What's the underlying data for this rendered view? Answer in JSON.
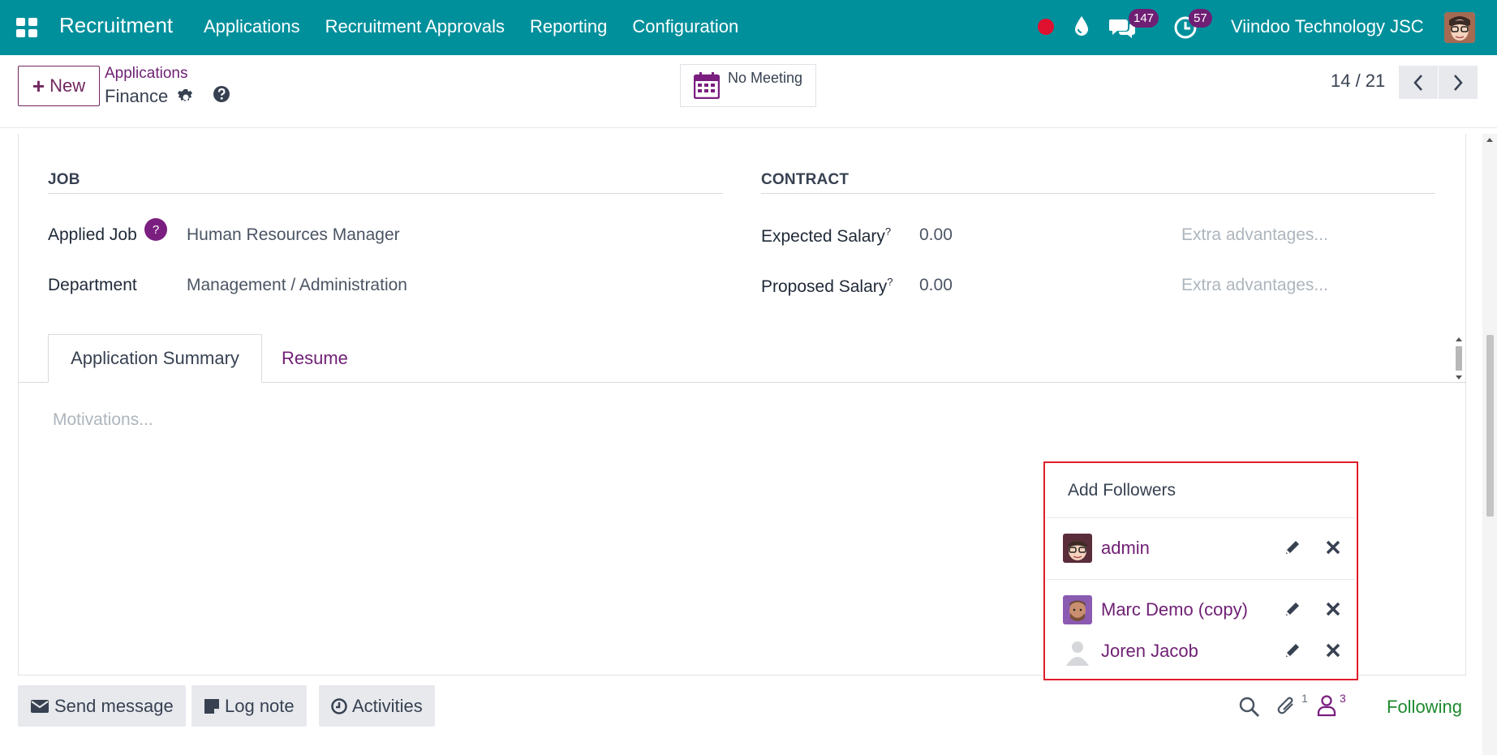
{
  "navbar": {
    "brand": "Recruitment",
    "menu": [
      "Applications",
      "Recruitment Approvals",
      "Reporting",
      "Configuration"
    ],
    "messages_count": "147",
    "activities_count": "57",
    "company": "Viindoo Technology JSC",
    "accent_color": "#00909c"
  },
  "control": {
    "new_label": "New",
    "breadcrumb_parent": "Applications",
    "breadcrumb_current": "Finance",
    "meeting_label": "No Meeting",
    "pager": "14 / 21"
  },
  "form": {
    "job_title": "JOB",
    "contract_title": "CONTRACT",
    "applied_job_label": "Applied Job",
    "applied_job_help": "?",
    "applied_job_value": "Human Resources Manager",
    "department_label": "Department",
    "department_value": "Management / Administration",
    "expected_salary_label": "Expected Salary",
    "expected_salary_value": "0.00",
    "expected_extra_placeholder": "Extra advantages...",
    "proposed_salary_label": "Proposed Salary",
    "proposed_salary_value": "0.00",
    "proposed_extra_placeholder": "Extra advantages...",
    "help_mark": "?",
    "tabs": [
      "Application Summary",
      "Resume"
    ],
    "motivations_placeholder": "Motivations..."
  },
  "followers": {
    "title": "Add Followers",
    "items": [
      {
        "name": "admin"
      },
      {
        "name": "Marc Demo (copy)"
      },
      {
        "name": "Joren Jacob"
      }
    ]
  },
  "chatter": {
    "send_message": "Send message",
    "log_note": "Log note",
    "activities": "Activities",
    "attachments_count": "1",
    "followers_count": "3",
    "following": "Following"
  }
}
